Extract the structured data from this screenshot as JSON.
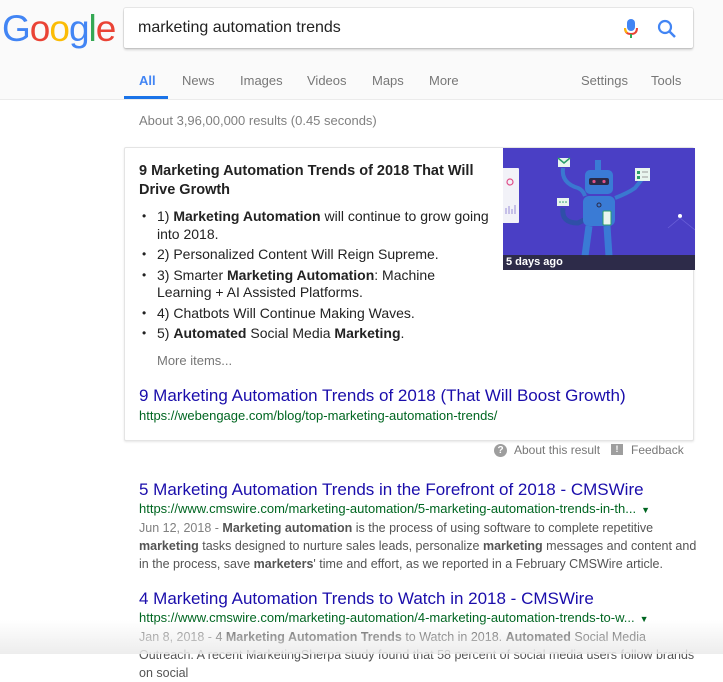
{
  "logo": {
    "letters": [
      "G",
      "o",
      "o",
      "g",
      "l",
      "e"
    ],
    "colors": [
      "#4285F4",
      "#EA4335",
      "#FBBC05",
      "#4285F4",
      "#34A853",
      "#EA4335"
    ]
  },
  "search": {
    "query": "marketing automation trends",
    "mic_icon": "microphone-icon",
    "search_icon": "magnifier-icon"
  },
  "tabs": [
    "All",
    "News",
    "Images",
    "Videos",
    "Maps",
    "More"
  ],
  "tools": {
    "settings": "Settings",
    "tools": "Tools"
  },
  "stats": "About 3,96,00,000 results (0.45 seconds)",
  "featured": {
    "title": "9 Marketing Automation Trends of 2018 That Will Drive Growth",
    "items": [
      [
        {
          "t": "1) ",
          "b": false
        },
        {
          "t": "Marketing Automation",
          "b": true
        },
        {
          "t": " will continue to grow going into 2018.",
          "b": false
        }
      ],
      [
        {
          "t": "2) Personalized Content Will Reign Supreme.",
          "b": false
        }
      ],
      [
        {
          "t": "3) Smarter ",
          "b": false
        },
        {
          "t": "Marketing Automation",
          "b": true
        },
        {
          "t": ": Machine Learning + AI Assisted Platforms.",
          "b": false
        }
      ],
      [
        {
          "t": "4) Chatbots Will Continue Making Waves.",
          "b": false
        }
      ],
      [
        {
          "t": "5) ",
          "b": false
        },
        {
          "t": "Automated",
          "b": true
        },
        {
          "t": " Social Media ",
          "b": false
        },
        {
          "t": "Marketing",
          "b": true
        },
        {
          "t": ".",
          "b": false
        }
      ]
    ],
    "more_items": "More items...",
    "image_caption": "5 days ago",
    "link_title": "9 Marketing Automation Trends of 2018 (That Will Boost Growth)",
    "url": "https://webengage.com/blog/top-marketing-automation-trends/"
  },
  "about": {
    "about_label": "About this result",
    "feedback_label": "Feedback"
  },
  "results": [
    {
      "title": "5 Marketing Automation Trends in the Forefront of 2018 - CMSWire",
      "url": "https://www.cmswire.com/marketing-automation/5-marketing-automation-trends-in-th...",
      "snippet": [
        {
          "t": "Jun 12, 2018 - ",
          "d": true
        },
        {
          "t": "Marketing automation",
          "b": true
        },
        {
          "t": " is the process of using software to complete repetitive "
        },
        {
          "t": "marketing",
          "b": true
        },
        {
          "t": " tasks designed to nurture sales leads, personalize "
        },
        {
          "t": "marketing",
          "b": true
        },
        {
          "t": " messages and content and in the process, save "
        },
        {
          "t": "marketers",
          "b": true
        },
        {
          "t": "' time and effort, as we reported in a February CMSWire article."
        }
      ]
    },
    {
      "title": "4 Marketing Automation Trends to Watch in 2018 - CMSWire",
      "url": "https://www.cmswire.com/marketing-automation/4-marketing-automation-trends-to-w...",
      "snippet": [
        {
          "t": "Jan 8, 2018 - ",
          "d": true
        },
        {
          "t": "4 "
        },
        {
          "t": "Marketing Automation Trends",
          "b": true
        },
        {
          "t": " to Watch in 2018. "
        },
        {
          "t": "Automated",
          "b": true
        },
        {
          "t": " Social Media Outreach. A recent MarketingSherpa study found that 58 percent of social media users follow brands on social"
        }
      ]
    }
  ]
}
